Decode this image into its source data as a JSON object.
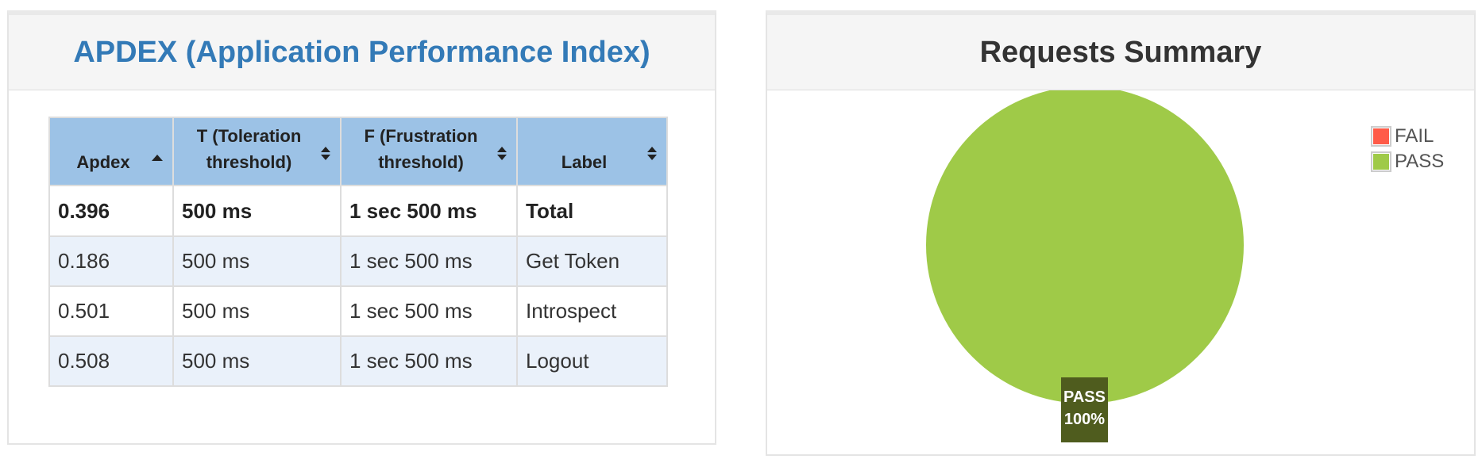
{
  "apdex_panel": {
    "title": "APDEX (Application Performance Index)",
    "columns": [
      {
        "label_line1": "Apdex",
        "label_line2": "",
        "sort": "ascending"
      },
      {
        "label_line1": "T (Toleration",
        "label_line2": "threshold)",
        "sort": "both"
      },
      {
        "label_line1": "F (Frustration",
        "label_line2": "threshold)",
        "sort": "both"
      },
      {
        "label_line1": "Label",
        "label_line2": "",
        "sort": "both"
      }
    ],
    "rows": [
      {
        "apdex": "0.396",
        "t": "500 ms",
        "f": "1 sec 500 ms",
        "label": "Total"
      },
      {
        "apdex": "0.186",
        "t": "500 ms",
        "f": "1 sec 500 ms",
        "label": "Get Token"
      },
      {
        "apdex": "0.501",
        "t": "500 ms",
        "f": "1 sec 500 ms",
        "label": "Introspect"
      },
      {
        "apdex": "0.508",
        "t": "500 ms",
        "f": "1 sec 500 ms",
        "label": "Logout"
      }
    ]
  },
  "summary_panel": {
    "title": "Requests Summary",
    "legend": [
      {
        "label": "FAIL",
        "color": "#ff5b48"
      },
      {
        "label": "PASS",
        "color": "#9fca48"
      }
    ],
    "pie_label": {
      "name": "PASS",
      "percent": "100%"
    }
  },
  "chart_data": {
    "type": "pie",
    "categories": [
      "FAIL",
      "PASS"
    ],
    "values": [
      0,
      100
    ],
    "colors": [
      "#ff5b48",
      "#9fca48"
    ],
    "legend_position": "top-right"
  }
}
